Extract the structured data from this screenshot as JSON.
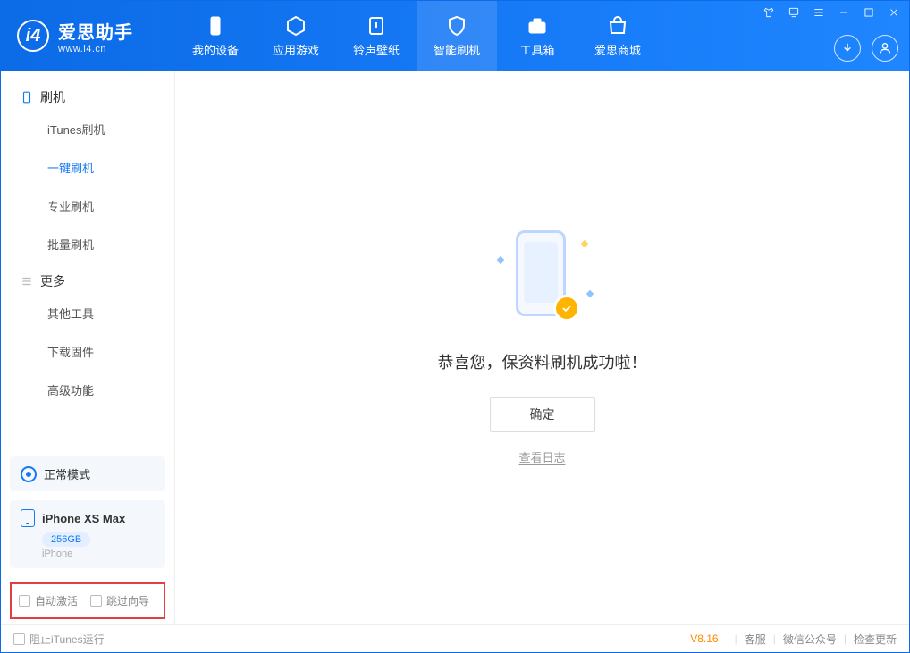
{
  "app": {
    "title": "爱思助手",
    "subtitle": "www.i4.cn"
  },
  "nav": {
    "device": "我的设备",
    "apps": "应用游戏",
    "ringtone": "铃声壁纸",
    "flash": "智能刷机",
    "toolbox": "工具箱",
    "store": "爱思商城"
  },
  "sidebar": {
    "group_flash": "刷机",
    "items_flash": {
      "itunes": "iTunes刷机",
      "oneclick": "一键刷机",
      "pro": "专业刷机",
      "batch": "批量刷机"
    },
    "group_more": "更多",
    "items_more": {
      "other": "其他工具",
      "firmware": "下载固件",
      "advanced": "高级功能"
    },
    "status_label": "正常模式",
    "device_name": "iPhone XS Max",
    "device_storage": "256GB",
    "device_type": "iPhone",
    "chk_auto_activate": "自动激活",
    "chk_skip_guide": "跳过向导"
  },
  "main": {
    "success_text": "恭喜您，保资料刷机成功啦！",
    "ok_button": "确定",
    "view_log": "查看日志"
  },
  "footer": {
    "block_itunes": "阻止iTunes运行",
    "version": "V8.16",
    "support": "客服",
    "wechat": "微信公众号",
    "check_update": "检查更新"
  }
}
